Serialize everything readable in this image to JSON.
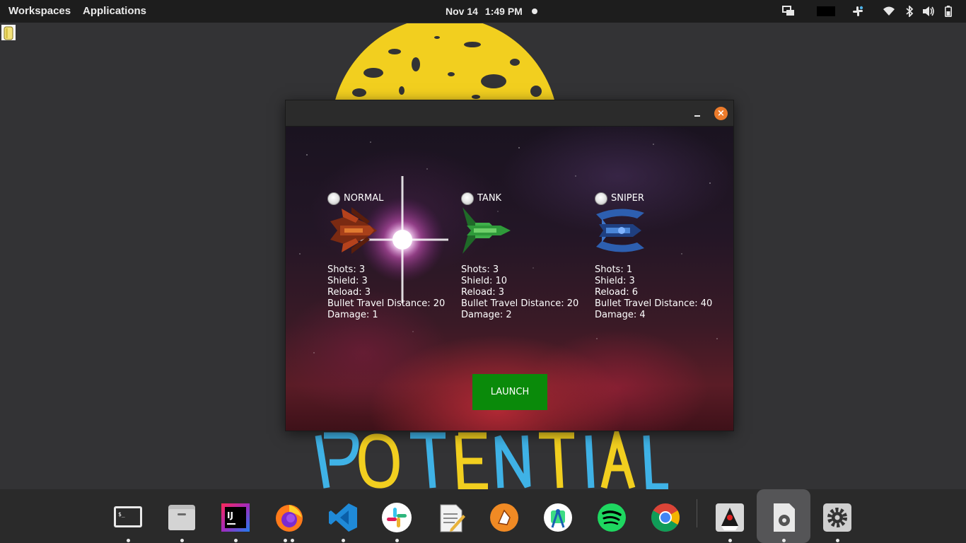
{
  "topbar": {
    "workspaces": "Workspaces",
    "applications": "Applications",
    "date": "Nov 14",
    "time": "1:49 PM"
  },
  "window": {
    "close_glyph": "×",
    "options": [
      {
        "label": "NORMAL",
        "ship_color": "#b5421c",
        "stats": [
          "Shots: 3",
          "Shield: 3",
          "Reload: 3",
          "Bullet Travel Distance: 20",
          "Damage: 1"
        ]
      },
      {
        "label": "TANK",
        "ship_color": "#2f9a3a",
        "stats": [
          "Shots: 3",
          "Shield: 10",
          "Reload: 3",
          "Bullet Travel Distance: 20",
          "Damage: 2"
        ]
      },
      {
        "label": "SNIPER",
        "ship_color": "#2d5fb0",
        "stats": [
          "Shots: 1",
          "Shield: 3",
          "Reload: 6",
          "Bullet Travel Distance: 40",
          "Damage: 4"
        ]
      }
    ],
    "launch_label": "LAUNCH"
  },
  "dock": {
    "items": [
      {
        "icon": "terminal-icon"
      },
      {
        "icon": "files-icon"
      },
      {
        "icon": "intellij-icon",
        "glyph": "IJ"
      },
      {
        "icon": "firefox-icon"
      },
      {
        "icon": "vscode-icon"
      },
      {
        "icon": "slack-icon"
      },
      {
        "icon": "text-editor-icon"
      },
      {
        "icon": "postman-icon"
      },
      {
        "icon": "android-studio-icon"
      },
      {
        "icon": "spotify-icon"
      },
      {
        "icon": "chrome-icon"
      },
      {
        "icon": "java-duke-icon"
      },
      {
        "icon": "settings-file-icon"
      },
      {
        "icon": "settings-gear-icon"
      }
    ]
  },
  "colors": {
    "topbar": "#1d1d1d",
    "desktop": "#333335",
    "launch": "#0a8a0a",
    "close": "#ec7b2b",
    "sun": "#f2cf1f"
  }
}
